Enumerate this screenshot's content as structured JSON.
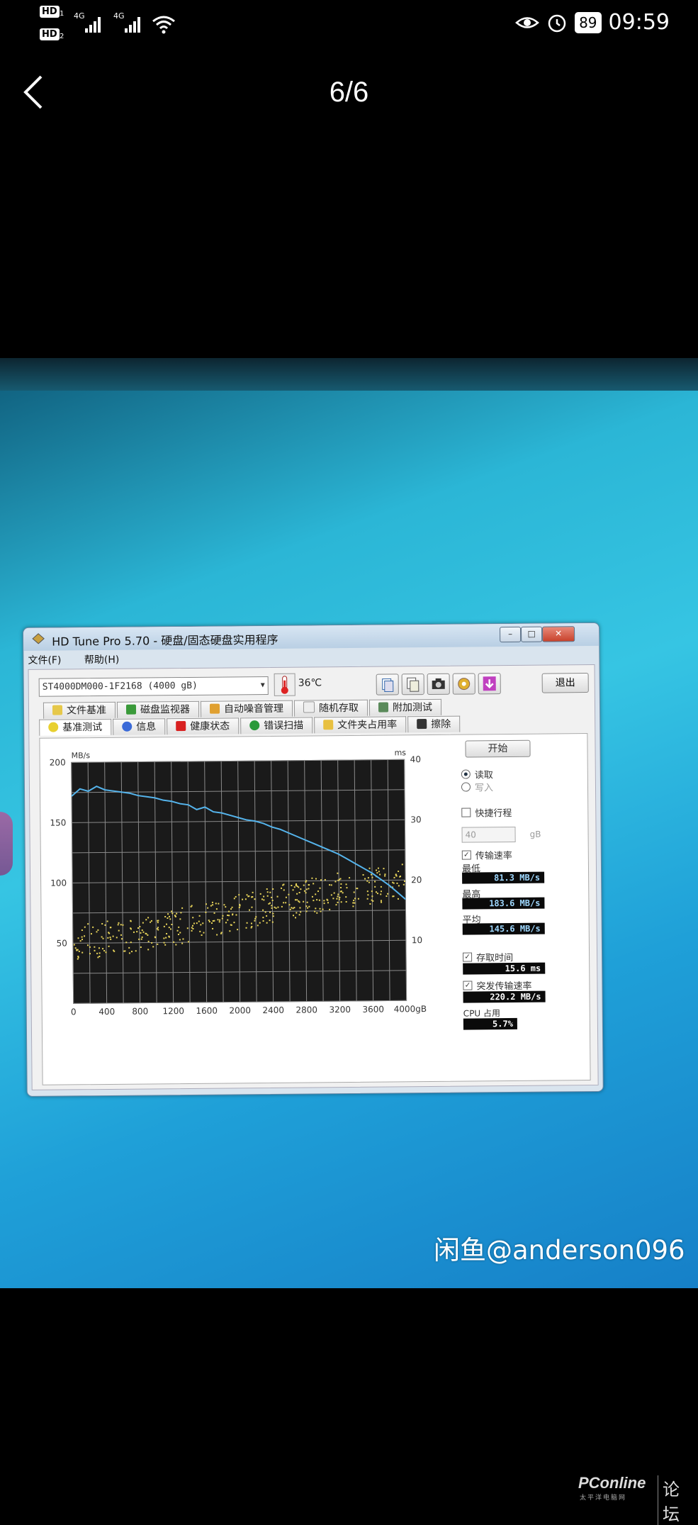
{
  "status_bar": {
    "sim1": "HD",
    "sim1_num": "1",
    "sim2": "HD",
    "sim2_num": "2",
    "net1": "4G",
    "net2": "4G",
    "battery": "89",
    "time": "09:59"
  },
  "viewer": {
    "counter": "6/6",
    "watermark": "闲鱼@anderson096",
    "logo_main": "PConline",
    "logo_sub": "太平洋电脑网",
    "logo_forum": "论坛"
  },
  "app": {
    "title": "HD Tune Pro 5.70 - 硬盘/固态硬盘实用程序",
    "menu": [
      "文件(F)",
      "帮助(H)"
    ],
    "drive": "ST4000DM000-1F2168 (4000 gB)",
    "temperature": "36℃",
    "exit_label": "退出",
    "tabs_row1": [
      "文件基准",
      "磁盘监视器",
      "自动噪音管理",
      "随机存取",
      "附加测试"
    ],
    "tabs_row2": [
      "基准测试",
      "信息",
      "健康状态",
      "错误扫描",
      "文件夹占用率",
      "擦除"
    ],
    "start_label": "开始",
    "read_label": "读取",
    "write_label": "写入",
    "short_stroke_label": "快捷行程",
    "short_stroke_value": "40",
    "short_stroke_unit": "gB",
    "transfer_label": "传输速率",
    "min_label": "最低",
    "min_value": "81.3 MB/s",
    "max_label": "最高",
    "max_value": "183.6 MB/s",
    "avg_label": "平均",
    "avg_value": "145.6 MB/s",
    "access_label": "存取时间",
    "access_value": "15.6 ms",
    "burst_label": "突发传输速率",
    "burst_value": "220.2 MB/s",
    "cpu_label": "CPU 占用",
    "cpu_value": "5.7%",
    "colors": {
      "transfer_line": "#55b4ec",
      "access_dots": "#e8d45a",
      "plot_bg": "#1a1a1a",
      "grid": "#8a8a8a"
    }
  },
  "chart_data": {
    "type": "line",
    "y_label_left": "MB/s",
    "y_label_right": "ms",
    "x_unit": "gB",
    "x_ticks": [
      "0",
      "400",
      "800",
      "1200",
      "1600",
      "2000",
      "2400",
      "2800",
      "3200",
      "3600",
      "4000gB"
    ],
    "y_ticks_left": [
      "200",
      "150",
      "100",
      "50"
    ],
    "y_ticks_right": [
      "40",
      "30",
      "20",
      "10"
    ],
    "xlim": [
      0,
      4000
    ],
    "ylim_left": [
      0,
      200
    ],
    "ylim_right": [
      0,
      40
    ],
    "grid": true,
    "series": [
      {
        "name": "传输速率",
        "axis": "left",
        "x": [
          0,
          100,
          200,
          300,
          400,
          500,
          600,
          700,
          800,
          900,
          1000,
          1100,
          1200,
          1300,
          1400,
          1500,
          1600,
          1700,
          1800,
          1900,
          2000,
          2100,
          2200,
          2300,
          2400,
          2500,
          2600,
          2700,
          2800,
          2900,
          3000,
          3100,
          3200,
          3300,
          3400,
          3500,
          3600,
          3700,
          3800,
          3900,
          4000
        ],
        "values": [
          172,
          178,
          176,
          180,
          177,
          176,
          175,
          174,
          172,
          171,
          170,
          168,
          167,
          165,
          164,
          160,
          162,
          158,
          157,
          155,
          153,
          151,
          150,
          148,
          145,
          143,
          140,
          137,
          134,
          131,
          128,
          125,
          122,
          118,
          114,
          110,
          106,
          101,
          96,
          90,
          84
        ]
      },
      {
        "name": "存取时间",
        "axis": "right",
        "style": "scatter",
        "x_range": [
          0,
          4000
        ],
        "trend_ms": [
          [
            0,
            10
          ],
          [
            1000,
            12
          ],
          [
            2000,
            15
          ],
          [
            3000,
            18
          ],
          [
            4000,
            20
          ]
        ],
        "spread_ms": 6,
        "count": 420
      }
    ]
  }
}
